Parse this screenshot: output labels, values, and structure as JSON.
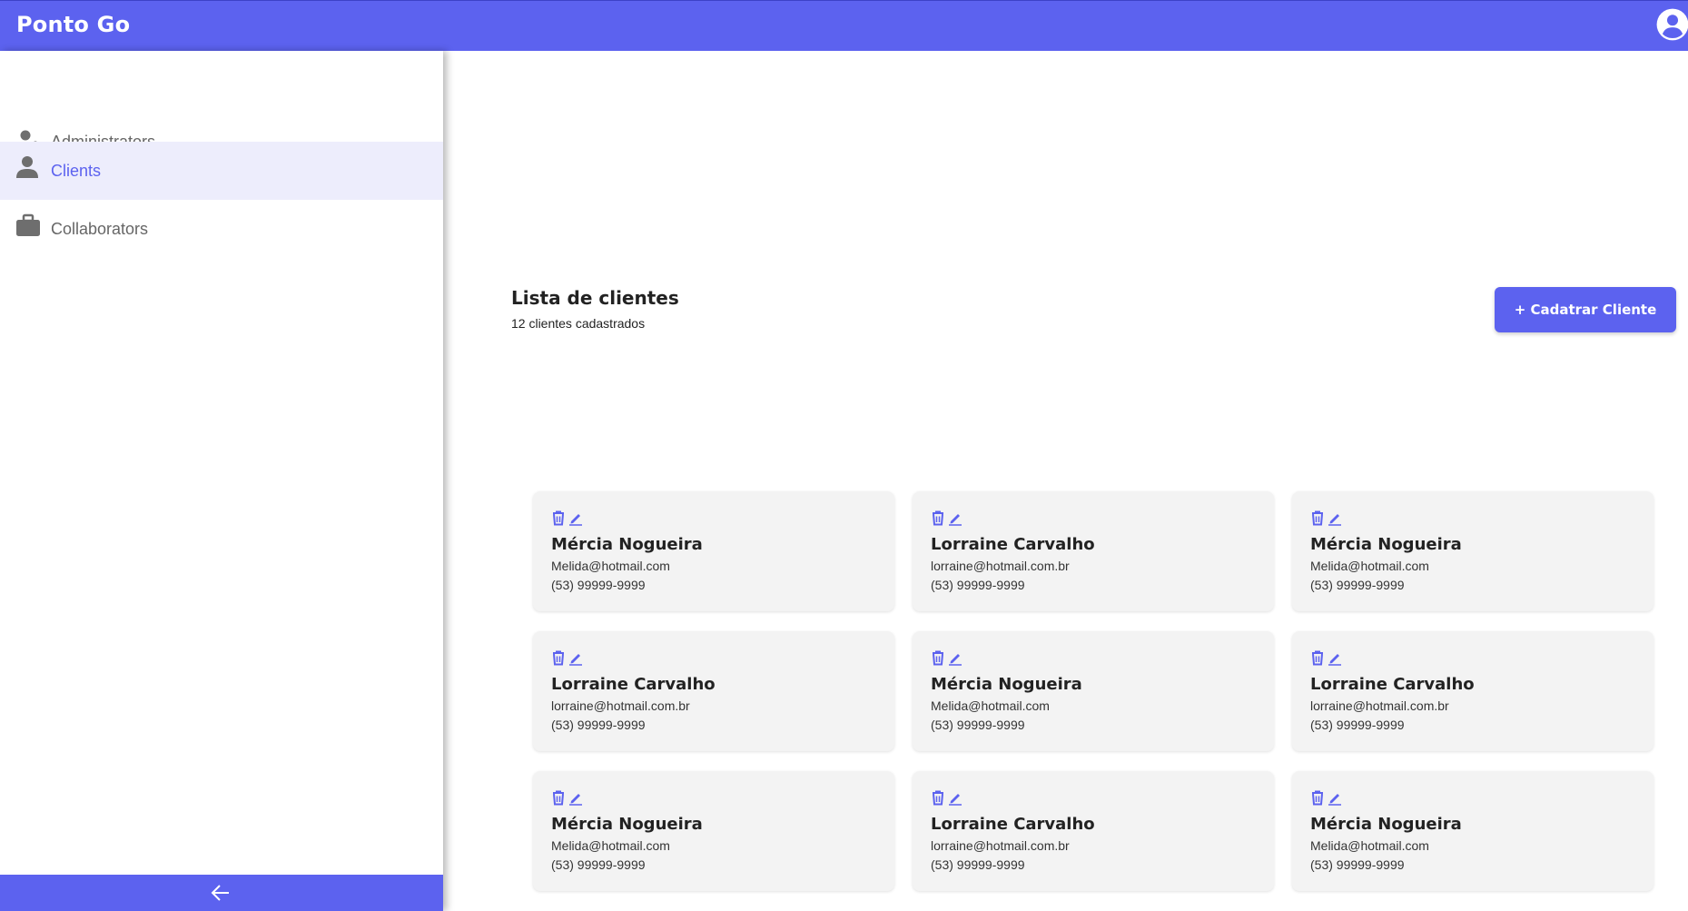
{
  "app": {
    "brand": "Ponto Go",
    "account_icon": "account-circle-icon",
    "accent_color": "#5c62ef"
  },
  "sidebar": {
    "items": [
      {
        "label": "Administrators",
        "icon": "user-gear-icon",
        "active": false
      },
      {
        "label": "Clients",
        "icon": "user-icon",
        "active": true
      },
      {
        "label": "Collaborators",
        "icon": "briefcase-icon",
        "active": false
      }
    ],
    "collapse_icon": "arrow-left-icon"
  },
  "main": {
    "title": "Lista de clientes",
    "subtitle": "12 clientes cadastrados",
    "add_button_label": "+ Cadatrar Cliente"
  },
  "clients": [
    {
      "name": "Mércia Nogueira",
      "email": "Melida@hotmail.com",
      "phone": "(53) 99999-9999"
    },
    {
      "name": "Lorraine Carvalho",
      "email": "lorraine@hotmail.com.br",
      "phone": "(53) 99999-9999"
    },
    {
      "name": "Mércia Nogueira",
      "email": "Melida@hotmail.com",
      "phone": "(53) 99999-9999"
    },
    {
      "name": "Lorraine Carvalho",
      "email": "lorraine@hotmail.com.br",
      "phone": "(53) 99999-9999"
    },
    {
      "name": "Mércia Nogueira",
      "email": "Melida@hotmail.com",
      "phone": "(53) 99999-9999"
    },
    {
      "name": "Lorraine Carvalho",
      "email": "lorraine@hotmail.com.br",
      "phone": "(53) 99999-9999"
    },
    {
      "name": "Mércia Nogueira",
      "email": "Melida@hotmail.com",
      "phone": "(53) 99999-9999"
    },
    {
      "name": "Lorraine Carvalho",
      "email": "lorraine@hotmail.com.br",
      "phone": "(53) 99999-9999"
    },
    {
      "name": "Mércia Nogueira",
      "email": "Melida@hotmail.com",
      "phone": "(53) 99999-9999"
    }
  ],
  "card_icons": {
    "delete": "trash-icon",
    "edit": "pencil-icon"
  }
}
